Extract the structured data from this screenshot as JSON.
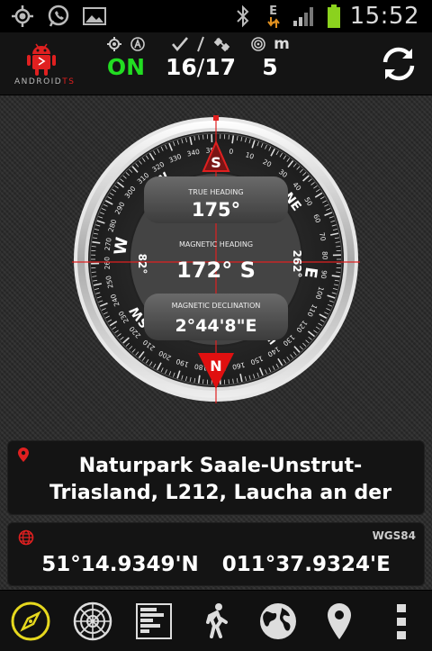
{
  "status_bar": {
    "time": "15:52",
    "icons": [
      "gps-fix-icon",
      "whatsapp-icon",
      "image-icon",
      "bluetooth-icon",
      "data-e-icon",
      "signal-icon",
      "battery-icon"
    ],
    "data_network_letter": "E"
  },
  "toolbar": {
    "logo_text_main": "ANDROID",
    "logo_text_accent": "TS",
    "gps_status": "ON",
    "satellites_used": "16",
    "satellites_separator": "/",
    "satellites_visible": "17",
    "accuracy_unit": "m",
    "accuracy_value": "5",
    "colors": {
      "on": "#22dd22",
      "accent": "#e02020"
    }
  },
  "compass": {
    "true_heading_label": "TRUE HEADING",
    "true_heading_value": "175°",
    "magnetic_heading_label": "MAGNETIC HEADING",
    "magnetic_heading_value": "172° S",
    "magnetic_declination_label": "MAGNETIC DECLINATION",
    "magnetic_declination_value": "2°44'8\"E",
    "left_bearing": "82°",
    "right_bearing": "262°",
    "heading_deg": 172,
    "cardinals": [
      "N",
      "NE",
      "E",
      "SE",
      "S",
      "SW",
      "W",
      "NW"
    ]
  },
  "address": {
    "line1": "Naturpark Saale-Unstrut-",
    "line2": "Triasland, L212, Laucha an der"
  },
  "coordinates": {
    "datum": "WGS84",
    "latitude": "51°14.9349'N",
    "longitude": "011°37.9324'E"
  },
  "bottom_nav": [
    "compass-icon",
    "radar-icon",
    "list-icon",
    "walk-icon",
    "globe-icon",
    "location-pin-icon",
    "more-vert-icon"
  ]
}
